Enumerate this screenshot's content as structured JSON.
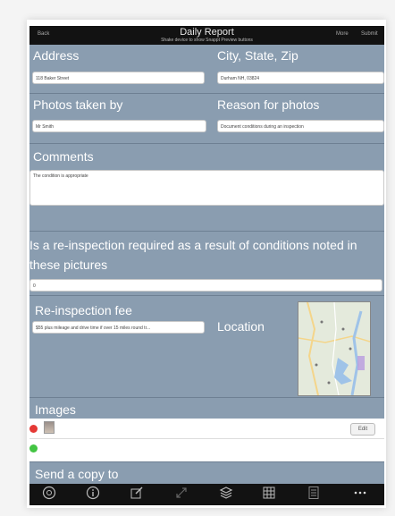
{
  "header": {
    "back_label": "Back",
    "title": "Daily Report",
    "subtitle": "Shake device to show Snappt Preview buttons",
    "more_label": "More",
    "submit_label": "Submit"
  },
  "fields": {
    "address_label": "Address",
    "address_value": "118 Baker Street",
    "city_label": "City, State, Zip",
    "city_value": "Durham NH, 03824",
    "photos_by_label": "Photos taken by",
    "photos_by_value": "Mr Smith",
    "reason_label": "Reason for photos",
    "reason_value": "Document conditions during an inspection",
    "comments_label": "Comments",
    "comments_value": "The condition is appropriate",
    "reinspection_question": "Is a re-inspection required as a result of conditions noted in these pictures",
    "reinspection_answer": "0",
    "fee_label": "Re-inspection fee",
    "fee_value": "$55 plus mileage and drive time if over 15 miles round tr...",
    "location_label": "Location",
    "images_label": "Images",
    "edit_label": "Edit",
    "send_copy_label": "Send a copy to"
  },
  "colors": {
    "form_bg": "#8a9db0",
    "bar_bg": "#121212",
    "delete_dot": "#e53935",
    "add_dot": "#43c443"
  },
  "toolbar_icons": [
    "info-circle-icon",
    "info-icon",
    "edit-icon",
    "expand-icon",
    "layers-icon",
    "grid-icon",
    "calculator-icon",
    "more-icon"
  ]
}
